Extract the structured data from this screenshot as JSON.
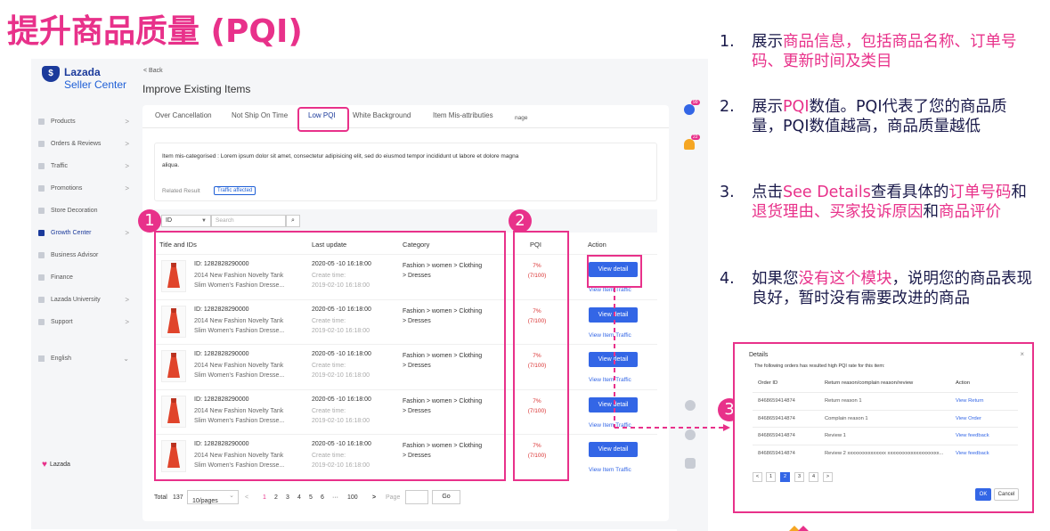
{
  "slide_title": "提升商品质量 (PQI)",
  "app": {
    "brand": {
      "line1": "Lazada",
      "line2": "Seller Center",
      "mark": "$"
    },
    "sidebar": {
      "items": [
        {
          "label": "Products",
          "chevron": ">"
        },
        {
          "label": "Orders & Reviews",
          "chevron": ">"
        },
        {
          "label": "Traffic",
          "chevron": ">"
        },
        {
          "label": "Promotions",
          "chevron": ">"
        },
        {
          "label": "Store Decoration",
          "chevron": ""
        },
        {
          "label": "Growth Center",
          "chevron": ">",
          "active": true
        },
        {
          "label": "Business Advisor",
          "chevron": ""
        },
        {
          "label": "Finance",
          "chevron": ""
        },
        {
          "label": "Lazada University",
          "chevron": ">"
        },
        {
          "label": "Support",
          "chevron": ">"
        }
      ],
      "language": "English",
      "language_chevron": "⌄",
      "bottom_logo": "Lazada"
    },
    "back_label": "< Back",
    "page_title": "Improve Existing Items",
    "tabs": [
      {
        "label": "Over Cancellation"
      },
      {
        "label": "Not Ship On Time"
      },
      {
        "label": "Low PQI",
        "active": true
      },
      {
        "label": "White Background"
      },
      {
        "label": "Item Mis-attributies"
      },
      {
        "label": "nage"
      }
    ],
    "info": {
      "text": "Item mis-categorised : Lorem ipsum dolor sit amet, consectetur adipisicing elit, sed do eiusmod tempor incididunt ut labore et dolore magna aliqua.",
      "related_label": "Related Result",
      "badge": "Traffic affected"
    },
    "filter": {
      "select_value": "ID",
      "search_placeholder": "Search",
      "search_button": "Q"
    },
    "table": {
      "headers": {
        "title": "Title and IDs",
        "update": "Last update",
        "category": "Category",
        "pqi": "PQI",
        "action": "Action"
      },
      "rows": [
        {
          "id": "ID: 1282828290000",
          "name1": "2014 New Fashion Novelty Tank",
          "name2": "Slim Women's Fashion Dresse...",
          "date": "2020-05 -10  16:18:00",
          "create_label": "Create time:",
          "create": "2019-02-10  16:18:00",
          "cat1": "Fashion > women > Clothing",
          "cat2": "> Dresses",
          "pqi": "7%",
          "pqi_detail": "(7/100)",
          "button": "View detail",
          "link": "View Item Traffic"
        },
        {
          "id": "ID: 1282828290000",
          "name1": "2014 New Fashion Novelty Tank",
          "name2": "Slim Women's Fashion Dresse...",
          "date": "2020-05 -10  16:18:00",
          "create_label": "Create time:",
          "create": "2019-02-10  16:18:00",
          "cat1": "Fashion > women > Clothing",
          "cat2": "> Dresses",
          "pqi": "7%",
          "pqi_detail": "(7/100)",
          "button": "View detail",
          "link": "View Item Traffic"
        },
        {
          "id": "ID: 1282828290000",
          "name1": "2014 New Fashion Novelty Tank",
          "name2": "Slim Women's Fashion Dresse...",
          "date": "2020-05 -10  16:18:00",
          "create_label": "Create time:",
          "create": "2019-02-10  16:18:00",
          "cat1": "Fashion > women > Clothing",
          "cat2": "> Dresses",
          "pqi": "7%",
          "pqi_detail": "(7/100)",
          "button": "View detail",
          "link": "View Item Traffic"
        },
        {
          "id": "ID: 1282828290000",
          "name1": "2014 New Fashion Novelty Tank",
          "name2": "Slim Women's Fashion Dresse...",
          "date": "2020-05 -10  16:18:00",
          "create_label": "Create time:",
          "create": "2019-02-10  16:18:00",
          "cat1": "Fashion > women > Clothing",
          "cat2": "> Dresses",
          "pqi": "7%",
          "pqi_detail": "(7/100)",
          "button": "View detail",
          "link": "View Item Traffic"
        },
        {
          "id": "ID: 1282828290000",
          "name1": "2014 New Fashion Novelty Tank",
          "name2": "Slim Women's Fashion Dresse...",
          "date": "2020-05 -10  16:18:00",
          "create_label": "Create time:",
          "create": "2019-02-10  16:18:00",
          "cat1": "Fashion > women > Clothing",
          "cat2": "> Dresses",
          "pqi": "7%",
          "pqi_detail": "(7/100)",
          "button": "View detail",
          "link": "View Item Traffic"
        }
      ]
    },
    "pager": {
      "total_label": "Total",
      "total": "137",
      "per_page": "10/pages",
      "per_page_chevron": "⌄",
      "prev": "<",
      "next": ">",
      "pages": [
        "1",
        "2",
        "3",
        "4",
        "5",
        "6",
        "···",
        "100"
      ],
      "page_label": "Page",
      "go": "Go"
    },
    "right_strip": {
      "msg_badge": "99",
      "bell_badge": "22"
    }
  },
  "annotations": {
    "n1": "1",
    "n2": "2",
    "n3": "3"
  },
  "steps": [
    {
      "num": "1.",
      "parts": [
        {
          "t": "展示",
          "hl": false
        },
        {
          "t": "商品信息，包括商品名称、订单号码、更新时间及类目",
          "hl": true
        }
      ]
    },
    {
      "num": "2.",
      "parts": [
        {
          "t": "展示",
          "hl": false
        },
        {
          "t": "PQI",
          "hl": true
        },
        {
          "t": "数值。PQI代表了您的商品质量，PQI数值越高，商品质量越低",
          "hl": false
        }
      ]
    },
    {
      "num": "3.",
      "parts": [
        {
          "t": "点击",
          "hl": false
        },
        {
          "t": "See Details",
          "hl": true
        },
        {
          "t": "查看具体的",
          "hl": false
        },
        {
          "t": "订单号码",
          "hl": true
        },
        {
          "t": "和",
          "hl": false
        },
        {
          "t": "退货理由、买家投诉原因",
          "hl": true
        },
        {
          "t": "和",
          "hl": false
        },
        {
          "t": "商品评价",
          "hl": true
        }
      ]
    },
    {
      "num": "4.",
      "parts": [
        {
          "t": "如果您",
          "hl": false
        },
        {
          "t": "没有这个模块",
          "hl": true
        },
        {
          "t": "，说明您的商品表现良好，暂时没有需要改进的商品",
          "hl": false
        }
      ]
    }
  ],
  "dialog": {
    "title": "Details",
    "close": "×",
    "subtitle": "The following orders has resulted high PQI rate for this item:",
    "headers": {
      "order": "Order ID",
      "reason": "Return reason/complain reason/review",
      "action": "Action"
    },
    "rows": [
      {
        "order": "8468659414874",
        "reason": "Return reason 1",
        "action": "View Return"
      },
      {
        "order": "8468659414874",
        "reason": "Complain reason 1",
        "action": "View Order"
      },
      {
        "order": "8468659414874",
        "reason": "Review 1",
        "action": "View feedback"
      },
      {
        "order": "8468659414874",
        "reason": "Review 2 xxxxxxxxxxxxxxx xxxxxxxxxxxxxxxxxxxx...",
        "action": "View feedback"
      }
    ],
    "pager": {
      "prev": "<",
      "pages": [
        "1",
        "2",
        "3",
        "4"
      ],
      "next": ">",
      "active": "2"
    },
    "ok": "OK",
    "cancel": "Cancel"
  },
  "colors": {
    "accent_pink": "#e8318a",
    "primary_blue": "#3366e6",
    "brand_navy": "#1b3a9b",
    "pqi_red": "#d92f2f"
  }
}
